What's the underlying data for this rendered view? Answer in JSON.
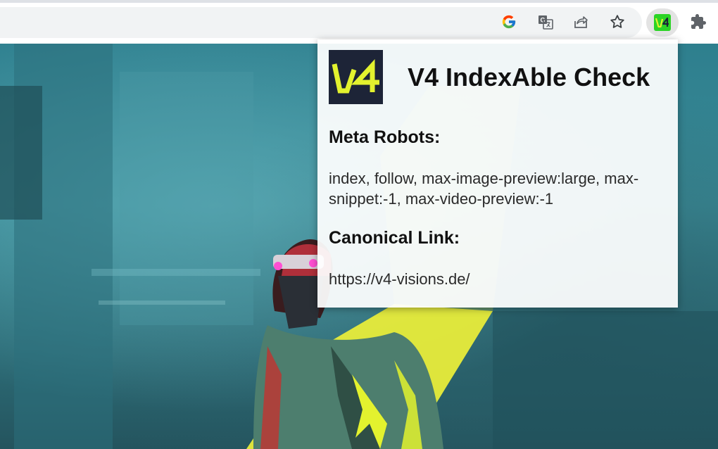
{
  "toolbar": {
    "icons": [
      "google-icon",
      "translate-icon",
      "share-icon",
      "star-icon",
      "v4-extension-icon",
      "puzzle-extensions-icon"
    ],
    "v4_badge_text": "V4",
    "accent_green": "#2bd425"
  },
  "popup": {
    "logo_text": "V4",
    "title": "V4 IndexAble Check",
    "meta_robots_heading": "Meta Robots:",
    "meta_robots_value": "index, follow, max-image-preview:large, max-snippet:-1, max-video-preview:-1",
    "canonical_heading": "Canonical Link:",
    "canonical_value": "https://v4-visions.de/",
    "logo_bg": "#1d2437",
    "logo_accent": "#e3f22e"
  }
}
